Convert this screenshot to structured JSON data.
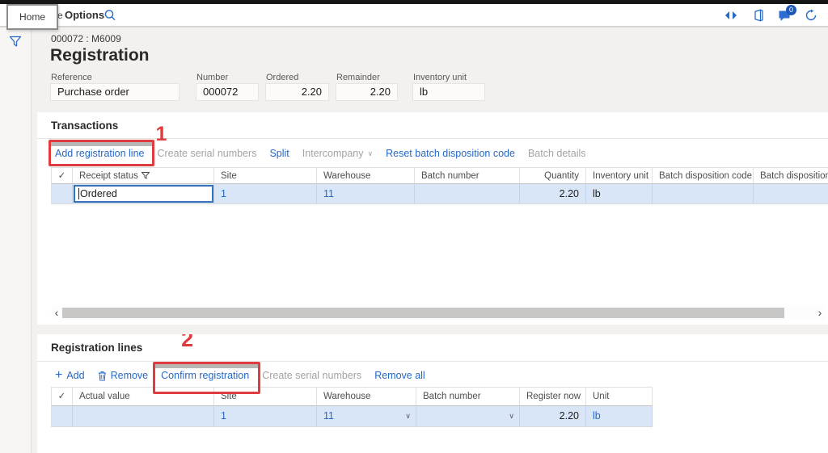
{
  "colors": {
    "accent_link": "#2569c7",
    "selection_row": "#d9e6f8",
    "annotation_red": "#e03b3f",
    "disabled_text": "#a5a3a1",
    "topbar_black": "#161616"
  },
  "topbar": {
    "home_tooltip": "Home",
    "hidden_tab_fragment": "e",
    "options_label": "Options",
    "notification_badge": "0"
  },
  "page": {
    "record_id": "000072 : M6009",
    "title": "Registration"
  },
  "header_fields": [
    {
      "label": "Reference",
      "value": "Purchase order"
    },
    {
      "label": "Number",
      "value": "000072"
    },
    {
      "label": "Ordered",
      "value": "2.20"
    },
    {
      "label": "Remainder",
      "value": "2.20"
    },
    {
      "label": "Inventory unit",
      "value": "lb"
    }
  ],
  "annotations": {
    "step_1": "1",
    "step_2": "2"
  },
  "transactions": {
    "title": "Transactions",
    "toolbar": {
      "add_registration_line": "Add registration line",
      "create_serial_numbers": "Create serial numbers",
      "split": "Split",
      "intercompany": "Intercompany",
      "reset_batch_disposition_code": "Reset batch disposition code",
      "batch_details": "Batch details"
    },
    "columns": {
      "select": "✓",
      "receipt_status": "Receipt status",
      "site": "Site",
      "warehouse": "Warehouse",
      "batch_number": "Batch number",
      "quantity": "Quantity",
      "inventory_unit": "Inventory unit",
      "batch_disposition_code": "Batch disposition code",
      "batch_disposition_status": "Batch disposition status"
    },
    "row": {
      "receipt_status": "Ordered",
      "site": "1",
      "warehouse": "11",
      "batch_number": "",
      "quantity": "2.20",
      "inventory_unit": "lb",
      "batch_disposition_code": "",
      "batch_disposition_status": ""
    }
  },
  "registration_lines": {
    "title": "Registration lines",
    "toolbar": {
      "add": "Add",
      "remove": "Remove",
      "confirm_registration": "Confirm registration",
      "create_serial_numbers": "Create serial numbers",
      "remove_all": "Remove all"
    },
    "columns": {
      "select": "✓",
      "actual_value": "Actual value",
      "site": "Site",
      "warehouse": "Warehouse",
      "batch_number": "Batch number",
      "register_now": "Register now",
      "unit": "Unit"
    },
    "row": {
      "actual_value": "",
      "site": "1",
      "warehouse": "11",
      "batch_number": "",
      "register_now": "2.20",
      "unit": "lb"
    }
  },
  "scrollbar": {
    "left_arrow": "‹",
    "right_arrow": "›"
  }
}
